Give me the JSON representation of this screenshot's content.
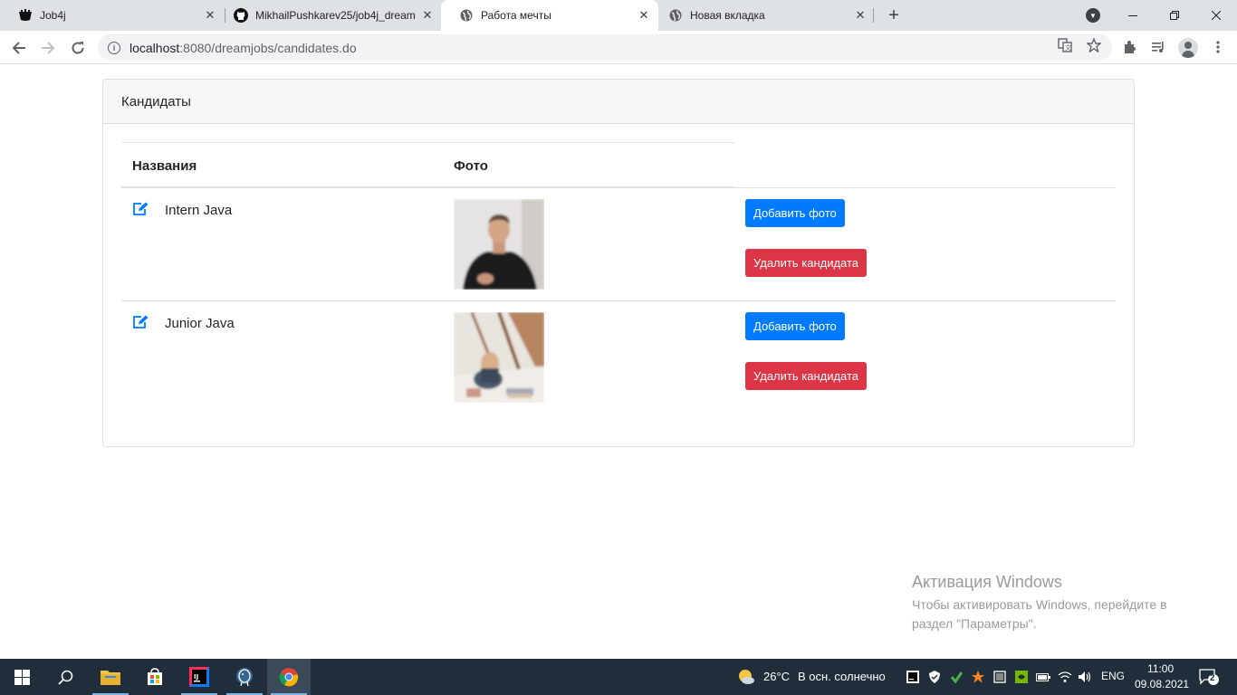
{
  "browser": {
    "tabs": [
      {
        "title": "Job4j",
        "icon": "job4j-icon"
      },
      {
        "title": "MikhailPushkarev25/job4j_dream",
        "icon": "github-icon"
      },
      {
        "title": "Работа мечты",
        "icon": "globe-icon"
      },
      {
        "title": "Новая вкладка",
        "icon": "globe-icon"
      }
    ],
    "url_host": "localhost",
    "url_path": ":8080/dreamjobs/candidates.do"
  },
  "page": {
    "card_title": "Кандидаты",
    "columns": [
      "Названия",
      "Фото"
    ],
    "rows": [
      {
        "name": "Intern Java",
        "add_photo": "Добавить фото",
        "delete": "Удалить кандидата"
      },
      {
        "name": "Junior Java",
        "add_photo": "Добавить фото",
        "delete": "Удалить кандидата"
      }
    ],
    "colors": {
      "primary": "#007bff",
      "danger": "#dc3545"
    }
  },
  "activation": {
    "title": "Активация Windows",
    "text": "Чтобы активировать Windows, перейдите в раздел \"Параметры\"."
  },
  "taskbar": {
    "temperature": "26°C",
    "weather": "В осн. солнечно",
    "lang": "ENG",
    "time": "11:00",
    "date": "09.08.2021",
    "notifications": "2"
  }
}
